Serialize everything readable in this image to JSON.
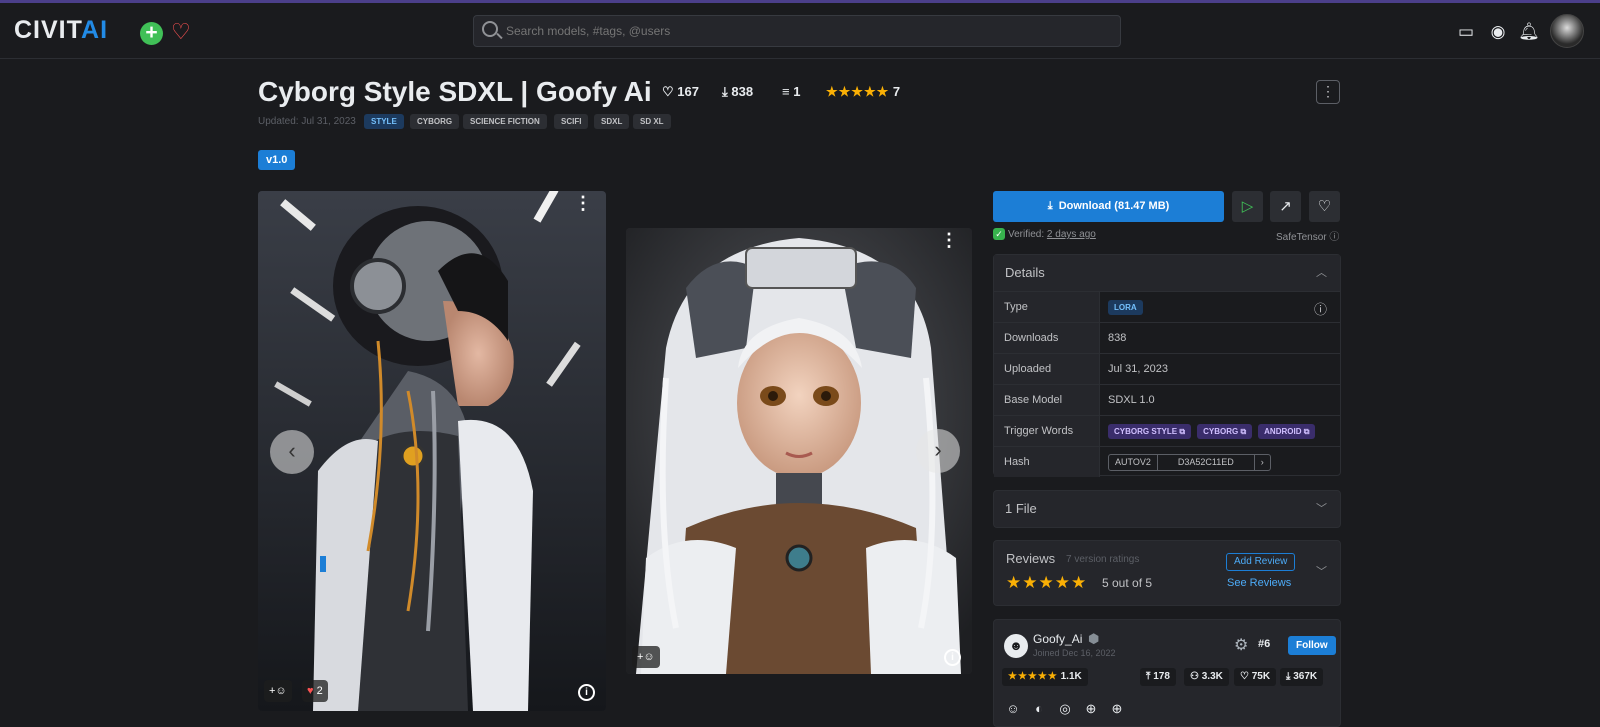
{
  "header": {
    "logo_main": "CIVIT",
    "logo_accent": "AI",
    "search_placeholder": "Search models, #tags, @users"
  },
  "model": {
    "title": "Cyborg Style SDXL | Goofy Ai",
    "likes": "167",
    "downloads": "838",
    "comments": "1",
    "rating_count": "7",
    "updated": "Updated: Jul 31, 2023",
    "tags": [
      "STYLE",
      "CYBORG",
      "SCIENCE FICTION",
      "SCIFI",
      "SDXL",
      "SD XL"
    ],
    "version": "v1.0"
  },
  "gallery": {
    "image1_reactions": "2"
  },
  "sidebar": {
    "download_label": "Download (81.47 MB)",
    "verified_prefix": "Verified:",
    "verified_when": "2 days ago",
    "safetensor": "SafeTensor",
    "details_title": "Details",
    "details": {
      "type_label": "Type",
      "type_value": "LORA",
      "downloads_label": "Downloads",
      "downloads_value": "838",
      "uploaded_label": "Uploaded",
      "uploaded_value": "Jul 31, 2023",
      "base_model_label": "Base Model",
      "base_model_value": "SDXL 1.0",
      "trigger_label": "Trigger Words",
      "trigger_words": [
        "CYBORG STYLE",
        "CYBORG",
        "ANDROID"
      ],
      "hash_label": "Hash",
      "hash_type": "AUTOV2",
      "hash_value": "D3A52C11ED"
    },
    "files_label": "1 File",
    "reviews": {
      "title": "Reviews",
      "count_text": "7 version ratings",
      "score_text": "5 out of 5",
      "add_review": "Add Review",
      "see_reviews": "See Reviews"
    },
    "creator": {
      "name": "Goofy_Ai",
      "joined": "Joined Dec 16, 2022",
      "rank": "#6",
      "follow": "Follow",
      "rating_count": "1.1K",
      "uploads": "178",
      "followers": "3.3K",
      "likes": "75K",
      "downloads": "367K"
    }
  }
}
